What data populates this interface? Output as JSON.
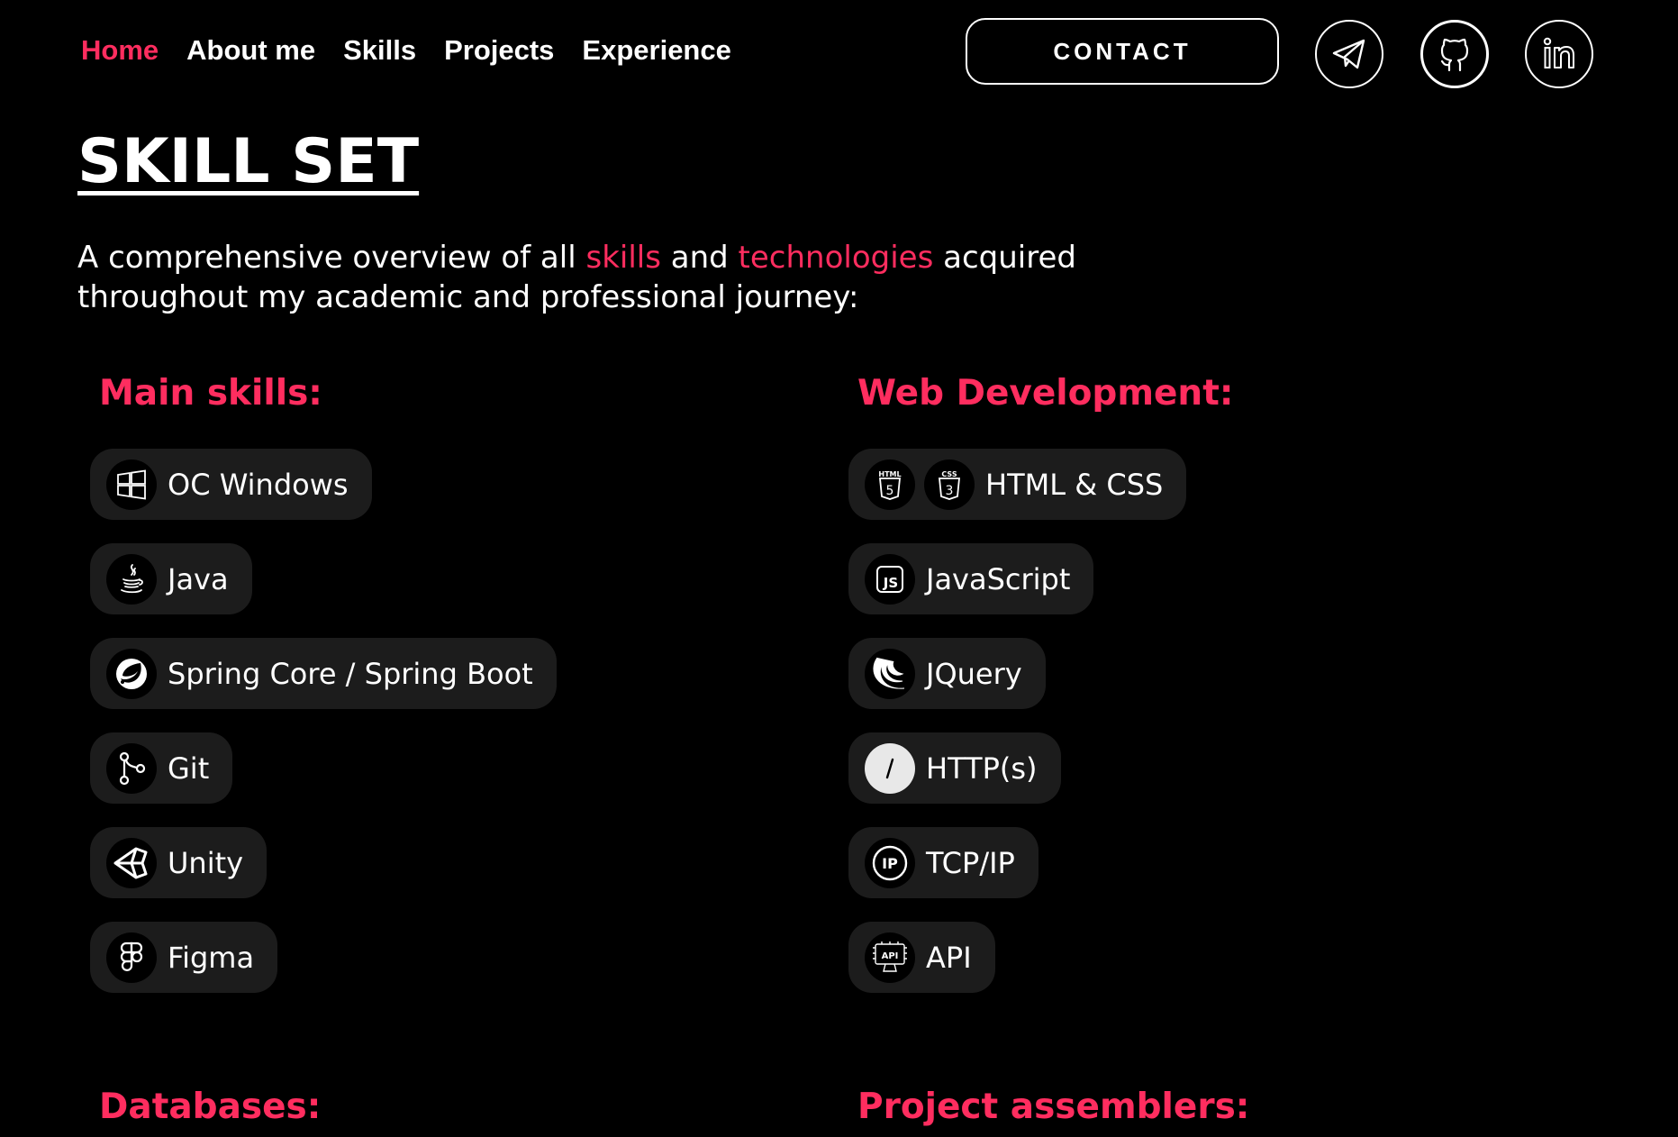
{
  "nav": {
    "items": [
      {
        "label": "Home",
        "active": true
      },
      {
        "label": "About me",
        "active": false
      },
      {
        "label": "Skills",
        "active": false
      },
      {
        "label": "Projects",
        "active": false
      },
      {
        "label": "Experience",
        "active": false
      }
    ]
  },
  "header": {
    "contact_label": "CONTACT",
    "social_icons": [
      "telegram-icon",
      "github-icon",
      "linkedin-icon"
    ]
  },
  "page": {
    "title": "SKILL SET",
    "intro": {
      "part1": "A comprehensive overview of all ",
      "highlight1": "skills",
      "part2": " and ",
      "highlight2": "technologies",
      "part3": " acquired throughout my academic and professional journey:"
    }
  },
  "sections": {
    "main": {
      "title": "Main skills:",
      "items": [
        {
          "label": "OC Windows",
          "icon": "windows-icon"
        },
        {
          "label": "Java",
          "icon": "java-icon"
        },
        {
          "label": "Spring Core / Spring Boot",
          "icon": "spring-icon"
        },
        {
          "label": "Git",
          "icon": "git-icon"
        },
        {
          "label": "Unity",
          "icon": "unity-icon"
        },
        {
          "label": "Figma",
          "icon": "figma-icon"
        }
      ]
    },
    "web": {
      "title": "Web Development:",
      "items": [
        {
          "label": "HTML & CSS",
          "icon": "html5-icon",
          "icon2": "css3-icon"
        },
        {
          "label": "JavaScript",
          "icon": "javascript-icon"
        },
        {
          "label": "JQuery",
          "icon": "jquery-icon"
        },
        {
          "label": "HTTP(s)",
          "icon": "http-icon"
        },
        {
          "label": "TCP/IP",
          "icon": "ip-icon"
        },
        {
          "label": "API",
          "icon": "api-icon"
        }
      ]
    },
    "databases": {
      "title": "Databases:"
    },
    "assemblers": {
      "title": "Project assemblers:"
    }
  },
  "colors": {
    "accent": "#ff2d5f",
    "background": "#000000",
    "pill": "#1c1c1c",
    "text": "#ffffff"
  }
}
